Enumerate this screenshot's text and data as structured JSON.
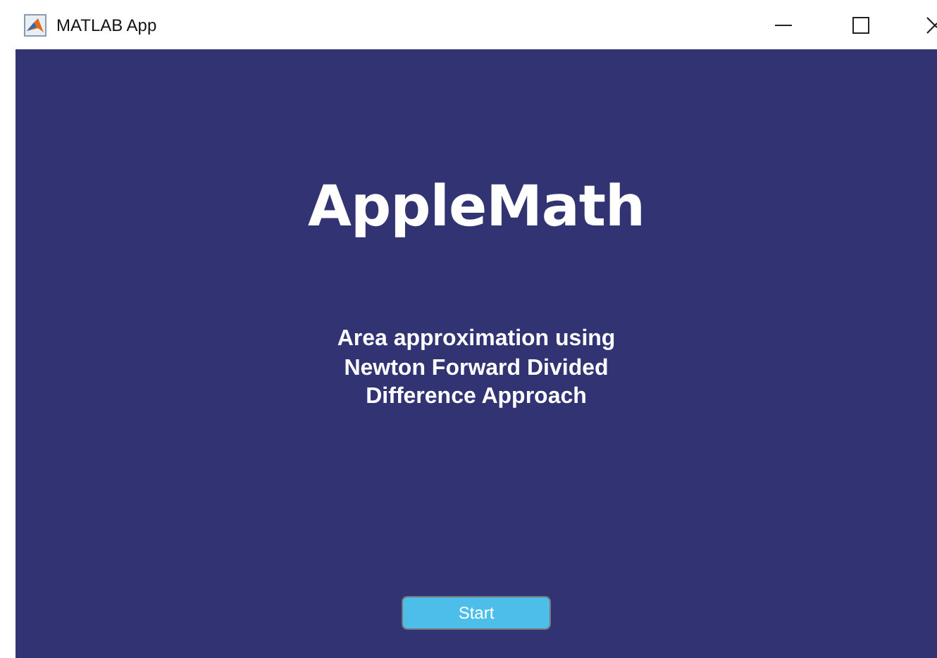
{
  "window": {
    "title": "MATLAB App"
  },
  "app": {
    "title": "AppleMath",
    "description": "Area approximation using Newton Forward Divided Difference Approach",
    "button": "Start"
  }
}
